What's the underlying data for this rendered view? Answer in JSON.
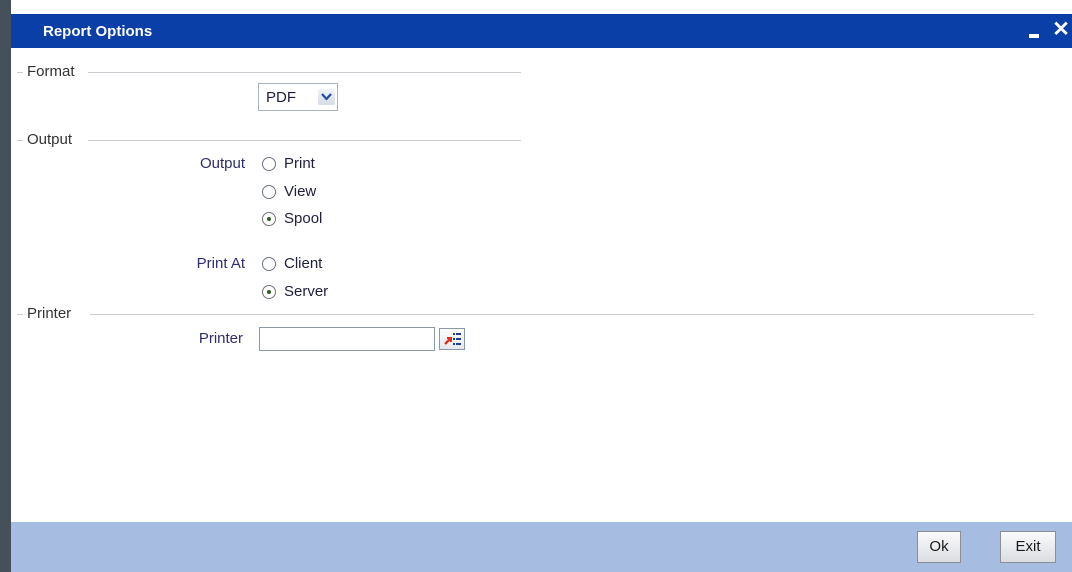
{
  "window": {
    "title": "Report Options",
    "minimize_icon": "minimize-icon",
    "close_icon": "close-icon",
    "close_glyph": "✕"
  },
  "format_section": {
    "legend": "Format",
    "format_select": {
      "selected": "PDF",
      "icon": "chevron-down-icon"
    }
  },
  "output_section": {
    "legend": "Output",
    "output_label": "Output",
    "output_options": [
      {
        "label": "Print",
        "checked": false
      },
      {
        "label": "View",
        "checked": false
      },
      {
        "label": "Spool",
        "checked": true
      }
    ],
    "print_at_label": "Print At",
    "print_at_options": [
      {
        "label": "Client",
        "checked": false
      },
      {
        "label": "Server",
        "checked": true
      }
    ]
  },
  "printer_section": {
    "legend": "Printer",
    "printer_label": "Printer",
    "printer_value": "",
    "lov_icon": "list-of-values-icon"
  },
  "footer": {
    "ok_label": "Ok",
    "exit_label": "Exit"
  },
  "colors": {
    "titlebar": "#0a3fa8",
    "footer": "#a6bce0",
    "label_text": "#2e2e6e"
  }
}
